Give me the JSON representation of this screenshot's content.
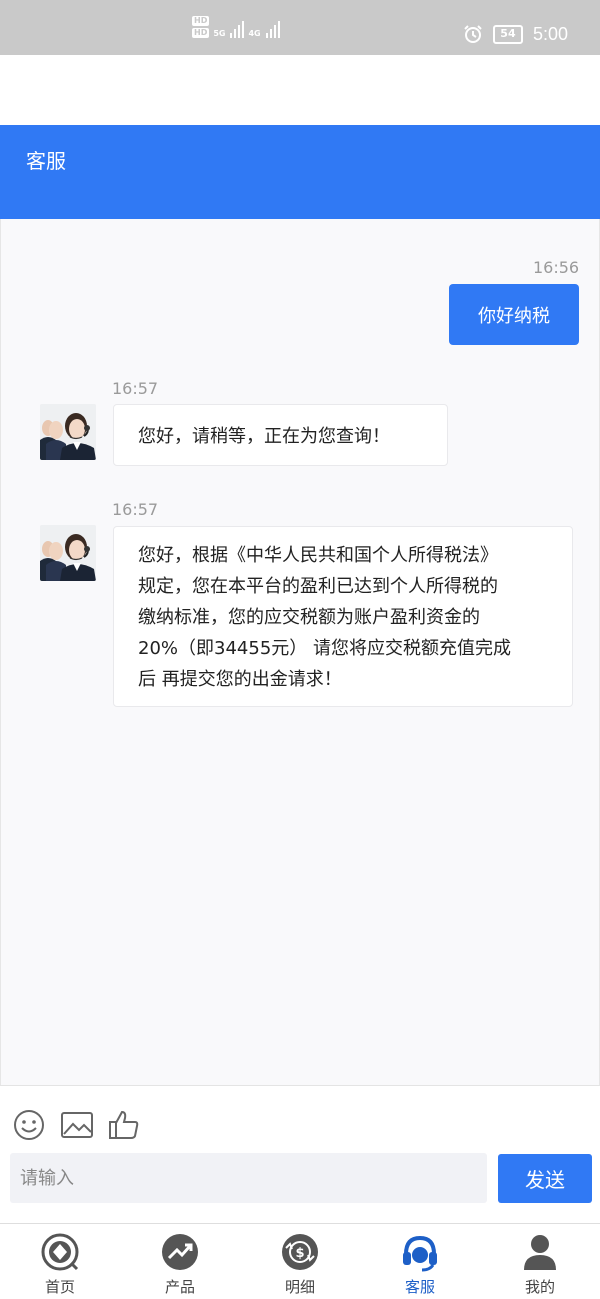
{
  "status_bar": {
    "hd_badges": [
      "HD",
      "HD"
    ],
    "network_labels": [
      "5G",
      "4G"
    ],
    "battery": "54",
    "time": "5:00"
  },
  "header": {
    "title": "客服"
  },
  "messages": [
    {
      "direction": "out",
      "time": "16:56",
      "text": "你好纳税"
    },
    {
      "direction": "in",
      "time": "16:57",
      "text": "您好，请稍等，正在为您查询！"
    },
    {
      "direction": "in",
      "time": "16:57",
      "lines": [
        "您好，根据《中华人民共和国个人所得税法》",
        "规定，您在本平台的盈利已达到个人所得税的",
        "缴纳标准，您的应交税额为账户盈利资金的",
        "20%（即34455元） 请您将应交税额充值完成",
        "后 再提交您的出金请求！"
      ]
    }
  ],
  "composer": {
    "placeholder": "请输入",
    "send_label": "发送",
    "tools": [
      "emoji-icon",
      "image-icon",
      "thumbs-up-icon"
    ]
  },
  "tabbar": {
    "items": [
      {
        "label": "首页",
        "icon": "home-icon"
      },
      {
        "label": "产品",
        "icon": "trend-icon"
      },
      {
        "label": "明细",
        "icon": "money-exchange-icon"
      },
      {
        "label": "客服",
        "icon": "headset-icon",
        "active": true
      },
      {
        "label": "我的",
        "icon": "user-icon"
      }
    ]
  },
  "colors": {
    "accent": "#3079f4",
    "active_tab": "#1d5fc7",
    "status_bar": "#c9c9c9",
    "chat_bg": "#f9f9fb"
  }
}
